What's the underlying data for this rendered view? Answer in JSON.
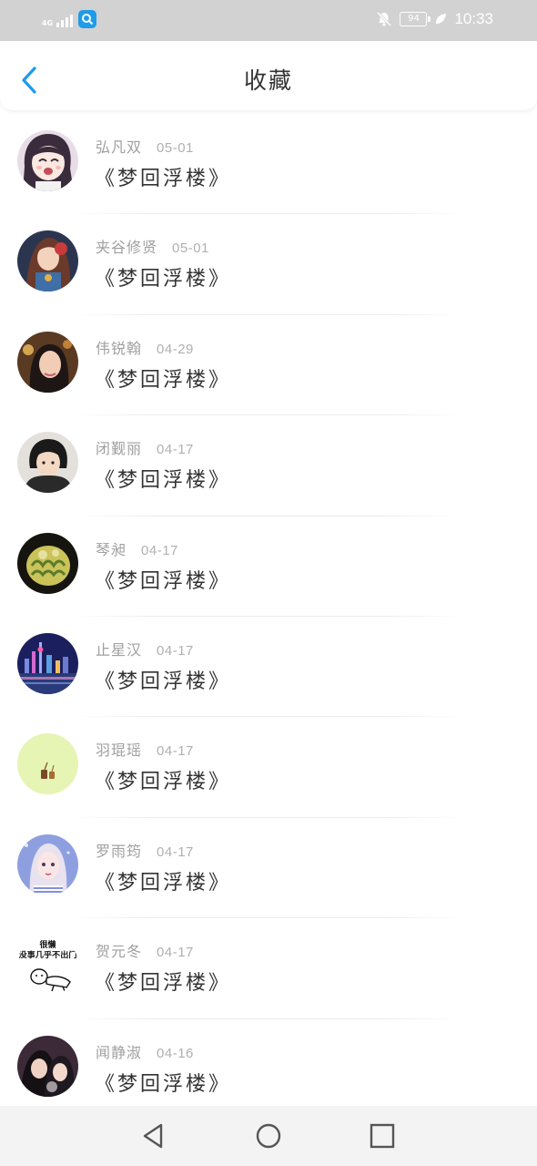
{
  "status_bar": {
    "network": "4G",
    "battery": "94",
    "time": "10:33"
  },
  "header": {
    "title": "收藏"
  },
  "favorites": [
    {
      "user": "弘凡双",
      "date": "05-01",
      "title": "《梦回浮楼》"
    },
    {
      "user": "夹谷修贤",
      "date": "05-01",
      "title": "《梦回浮楼》"
    },
    {
      "user": "伟锐翰",
      "date": "04-29",
      "title": "《梦回浮楼》"
    },
    {
      "user": "闭觐丽",
      "date": "04-17",
      "title": "《梦回浮楼》"
    },
    {
      "user": "琴昶",
      "date": "04-17",
      "title": "《梦回浮楼》"
    },
    {
      "user": "止星汉",
      "date": "04-17",
      "title": "《梦回浮楼》"
    },
    {
      "user": "羽琨瑶",
      "date": "04-17",
      "title": "《梦回浮楼》"
    },
    {
      "user": "罗雨筠",
      "date": "04-17",
      "title": "《梦回浮楼》"
    },
    {
      "user": "贺元冬",
      "date": "04-17",
      "title": "《梦回浮楼》"
    },
    {
      "user": "闻静淑",
      "date": "04-16",
      "title": "《梦回浮楼》"
    }
  ],
  "avatar_meme": {
    "line1": "很懒",
    "line2": "没事几乎不出门"
  },
  "colors": {
    "accent": "#1e9be9",
    "status_bar": "#d2d2d2",
    "nav_bar": "#f3f3f3"
  }
}
